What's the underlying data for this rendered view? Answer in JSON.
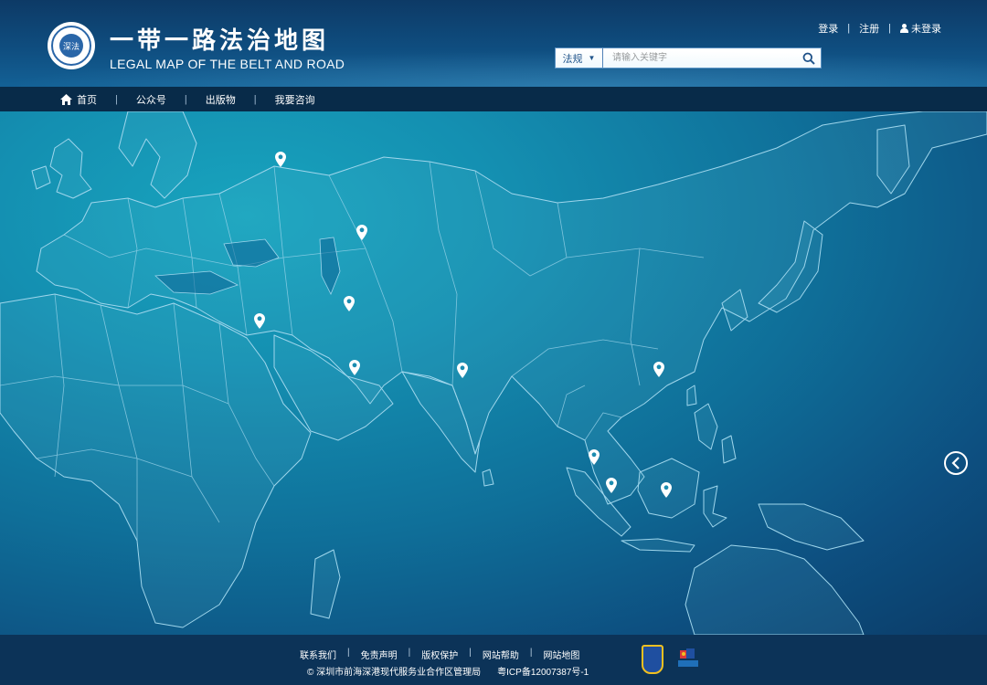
{
  "header": {
    "logo_text": "深法",
    "title": "一带一路法治地图",
    "subtitle": "LEGAL MAP OF THE BELT AND ROAD",
    "login": "登录",
    "register": "注册",
    "status": "未登录",
    "separator": "|"
  },
  "search": {
    "category": "法规",
    "placeholder": "请输入关键字"
  },
  "nav": {
    "items": [
      {
        "label": "首页",
        "icon": "home-icon"
      },
      {
        "label": "公众号"
      },
      {
        "label": "出版物"
      },
      {
        "label": "我要咨询"
      }
    ],
    "separator": "|"
  },
  "map": {
    "marker_color": "#ffffff",
    "land_stroke": "#9fd6ec",
    "marker_count": 11,
    "next_icon": "chevron-left-circle-icon"
  },
  "footer": {
    "links": [
      "联系我们",
      "免责声明",
      "版权保护",
      "网站帮助",
      "网站地图"
    ],
    "separator": "|",
    "copyright": "© 深圳市前海深港现代服务业合作区管理局",
    "icp": "粤ICP备12007387号-1"
  }
}
